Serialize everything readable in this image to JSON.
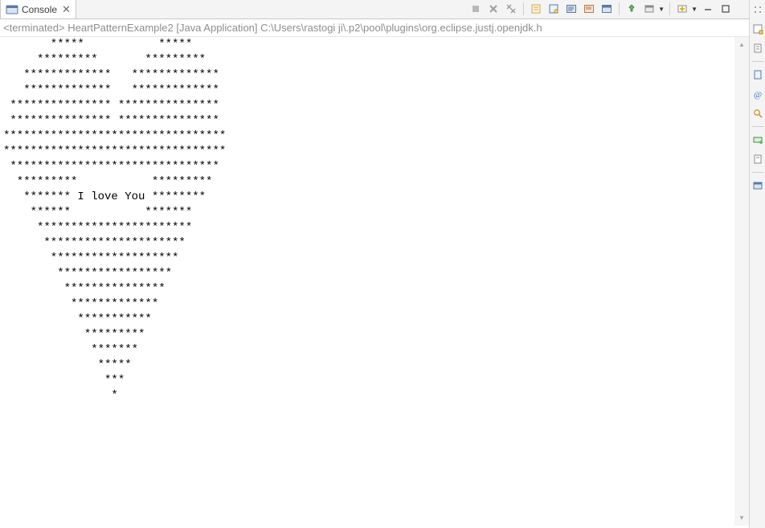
{
  "tab": {
    "title": "Console",
    "close_glyph": "✕"
  },
  "run_info": "<terminated> HeartPatternExample2 [Java Application] C:\\Users\\rastogi ji\\.p2\\pool\\plugins\\org.eclipse.justj.openjdk.h",
  "console_output": "       *****           *****\n     *********       *********\n   *************   *************\n   *************   *************\n *************** ***************\n *************** ***************\n*********************************\n*********************************\n *******************************\n  *********           *********\n   ******* I love You ********\n    ******           *******\n     ***********************\n      *********************\n       *******************\n        *****************\n         ***************\n          *************\n           ***********\n            *********\n             *******\n              *****\n               ***\n                *",
  "toolbar": {
    "terminate": "■",
    "remove_launch": "✖",
    "remove_all": "✖✖",
    "scroll_lock": "▣",
    "clear_console": "▢",
    "pin_console": "📌",
    "open_console": "▣",
    "display_selected": "▣",
    "show_console": "▢",
    "minimize": "–",
    "maximize": "▭"
  },
  "gutter": {
    "outline": "outline-view-icon",
    "task_list": "task-list-icon",
    "minimap": "minimap-icon",
    "at": "at-icon",
    "search": "search-icon",
    "breakpoints": "breakpoints-icon",
    "snippets": "snippets-icon",
    "console": "console-icon"
  }
}
